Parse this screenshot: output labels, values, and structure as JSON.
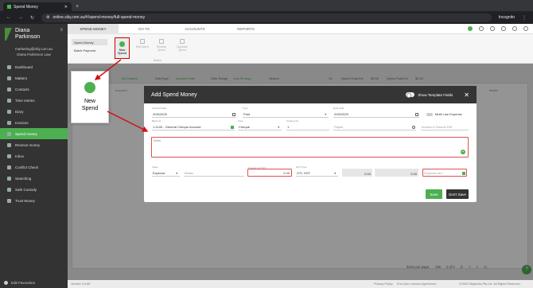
{
  "browser": {
    "tab_title": "Spend Money",
    "url": "online.silq.com.au/#/spend-money/full-spend-money",
    "incognito_label": "Incognito"
  },
  "sidebar": {
    "user_first": "Diana",
    "user_last": "Parkinson",
    "email": "marketing@silq.com.au",
    "firm": "Diana Parkinson Law",
    "items": [
      {
        "label": "Dashboard"
      },
      {
        "label": "Matters"
      },
      {
        "label": "Contacts"
      },
      {
        "label": "Time entries"
      },
      {
        "label": "Diary"
      },
      {
        "label": "Invoices"
      },
      {
        "label": "Spend money"
      },
      {
        "label": "Receive money"
      },
      {
        "label": "Inbox"
      },
      {
        "label": "Conflict Check"
      },
      {
        "label": "Searching"
      },
      {
        "label": "Safe Custody"
      },
      {
        "label": "Trust Money"
      }
    ],
    "footer": "Edit Favourites",
    "version": "Version 3.5.86"
  },
  "topnav": {
    "tabs": [
      "SPEND MONEY",
      "GO TO",
      "ACCOUNTS",
      "REPORTS"
    ]
  },
  "ribbon": {
    "spend_money": "Spend Money",
    "batch_payment": "Batch Payment",
    "new_spend": "New Spend",
    "ghost1": "Edit Spend",
    "ghost2": "Reverse Spend",
    "ghost3": "Duplicate Spend",
    "group_label": "Action"
  },
  "filters": {
    "all_classes": "All Classes",
    "date_type_label": "DateType",
    "date_type_value": "Incurred Date",
    "date_range_label": "Date Range",
    "date_range_value": "Last 90 days",
    "search_placeholder": "Search",
    "count": "13",
    "total_inc_label": "Spend Total Inc",
    "total_inc_value": "$0.00",
    "total_ex_label": "Spend Total Ex",
    "total_ex_value": "$0.00"
  },
  "grid": {
    "col_left": "Incurred",
    "col_right": "Matter",
    "items_per_page": "Items per page:",
    "items_per_page_value": "100",
    "range": "0 of 0"
  },
  "modal": {
    "title": "Add Spend Money",
    "template_fields_label": "Show Template Fields",
    "incurred_date_label": "Incurred Date",
    "incurred_date": "20/5/2025",
    "type_label": "Type",
    "type_value": "Paid",
    "date_paid_label": "Date Paid",
    "date_paid": "20/5/2025",
    "multi_line_label": "Multi Line Expense",
    "bank_label": "Bank a/c",
    "bank_value": "1-1100 - General Cheque Account",
    "type2_label": "Type",
    "type2_value": "Cheque",
    "cheque_label": "Cheque No",
    "cheque_value": "1",
    "payee_placeholder": "Payee",
    "invoice_placeholder": "Invoice # /Source Ref",
    "notes_label": "Notes",
    "class_label": "Class",
    "class_value": "Expense",
    "matter_placeholder": "Matter",
    "amount_label": "Amount Inc GST",
    "amount_value": "0.00",
    "gst_type_label": "GST Type",
    "gst_type_value": "GTL GST",
    "gst_value": "0.00",
    "gst_value2": "0.00",
    "expense_placeholder": "Expense a/c *",
    "save_label": "Save",
    "dont_save_label": "Don't Save"
  },
  "callout": {
    "line1": "New",
    "line2": "Spend"
  },
  "footer": {
    "privacy": "Privacy Policy",
    "eula": "End User Licence Agreement",
    "copyright": "©2025 Silqworks Pty Ltd. All Rights Reserved"
  }
}
